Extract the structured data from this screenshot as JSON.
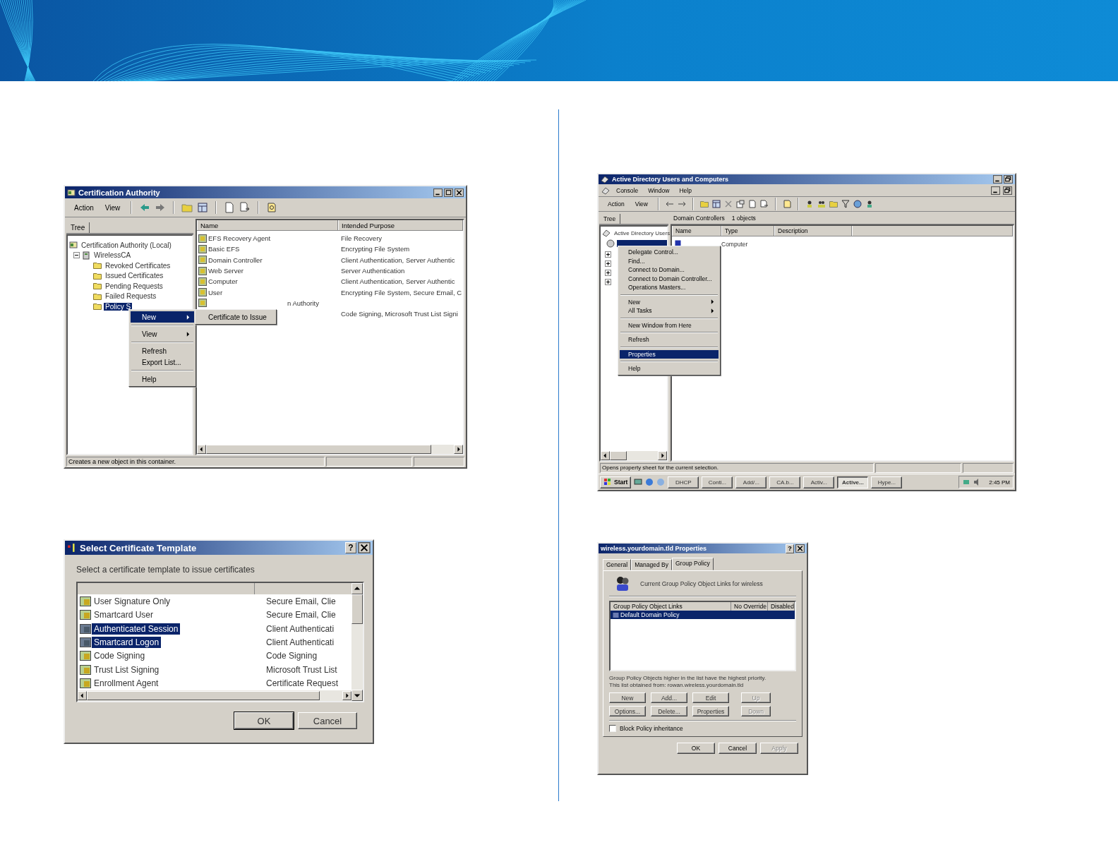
{
  "ca_window": {
    "title": "Certification Authority",
    "menu": [
      "Action",
      "View"
    ],
    "tree_tab": "Tree",
    "tree": [
      {
        "label": "Certification Authority (Local)",
        "selected": false,
        "children": [
          {
            "label": "WirelessCA",
            "selected": false,
            "children": [
              {
                "label": "Revoked Certificates",
                "selected": false
              },
              {
                "label": "Issued Certificates",
                "selected": false
              },
              {
                "label": "Pending Requests",
                "selected": false
              },
              {
                "label": "Failed Requests",
                "selected": false
              },
              {
                "label": "Policy S",
                "selected": true
              }
            ]
          }
        ]
      }
    ],
    "columns": [
      "Name",
      "Intended Purpose"
    ],
    "rows": [
      {
        "name": "EFS Recovery Agent",
        "purpose": "File Recovery"
      },
      {
        "name": "Basic EFS",
        "purpose": "Encrypting File System"
      },
      {
        "name": "Domain Controller",
        "purpose": "Client Authentication, Server Authentic"
      },
      {
        "name": "Web Server",
        "purpose": "Server Authentication"
      },
      {
        "name": "Computer",
        "purpose": "Client Authentication, Server Authentic"
      },
      {
        "name": "User",
        "purpose": "Encrypting File System, Secure Email, C"
      },
      {
        "name": "n Authority"
      },
      {
        "purpose": "Code Signing, Microsoft Trust List Signi"
      }
    ],
    "context_menu": [
      {
        "items": [
          {
            "label": "New",
            "submenu": true,
            "selected": true
          }
        ]
      },
      {
        "items": [
          {
            "label": "View",
            "submenu": true,
            "selected": false
          }
        ]
      },
      {
        "items": [
          {
            "label": "Refresh",
            "submenu": false,
            "selected": false
          },
          {
            "label": "Export List...",
            "submenu": false,
            "selected": false
          }
        ]
      },
      {
        "items": [
          {
            "label": "Help",
            "submenu": false,
            "selected": false
          }
        ]
      }
    ],
    "submenu": [
      {
        "label": "Certificate to Issue",
        "selected": false
      }
    ],
    "status_bar": "Creates a new object in this container."
  },
  "ad_window": {
    "title": "Active Directory Users and Computers",
    "menu": [
      "Console",
      "Window",
      "Help"
    ],
    "toolbar_menu": [
      "Action",
      "View"
    ],
    "tree_tab": "Tree",
    "pane_title": "Domain Controllers",
    "pane_count": "1 objects",
    "tree": [
      {
        "label": "Active Directory Users",
        "selected": false,
        "children": [
          {
            "selected": true
          }
        ]
      }
    ],
    "columns": [
      "Name",
      "Type",
      "Description"
    ],
    "rows": [
      {
        "type": "Computer"
      }
    ],
    "context_menu": [
      {
        "items": [
          {
            "label": "Delegate Control...",
            "submenu": false,
            "selected": false
          },
          {
            "label": "Find...",
            "submenu": false,
            "selected": false
          },
          {
            "label": "Connect to Domain...",
            "submenu": false,
            "selected": false
          },
          {
            "label": "Connect to Domain Controller...",
            "submenu": false,
            "selected": false
          },
          {
            "label": "Operations Masters...",
            "submenu": false,
            "selected": false
          }
        ]
      },
      {
        "items": [
          {
            "label": "New",
            "submenu": true,
            "selected": false
          },
          {
            "label": "All Tasks",
            "submenu": true,
            "selected": false
          }
        ]
      },
      {
        "items": [
          {
            "label": "New Window from Here",
            "submenu": false,
            "selected": false
          }
        ]
      },
      {
        "items": [
          {
            "label": "Refresh",
            "submenu": false,
            "selected": false
          }
        ]
      },
      {
        "items": [
          {
            "label": "Properties",
            "submenu": false,
            "selected": true
          }
        ]
      },
      {
        "items": [
          {
            "label": "Help",
            "submenu": false,
            "selected": false
          }
        ]
      }
    ],
    "status_bar": "Opens property sheet for the current selection.",
    "taskbar": {
      "start": "Start",
      "items": [
        {
          "label": "DHCP",
          "selected": false
        },
        {
          "label": "Conti...",
          "selected": false
        },
        {
          "label": "Add/...",
          "selected": false
        },
        {
          "label": "CA.b...",
          "selected": false
        },
        {
          "label": "Activ...",
          "selected": false
        },
        {
          "label": "Active...",
          "selected": true
        },
        {
          "label": "Hype...",
          "selected": false
        }
      ],
      "clock": "2:45 PM"
    }
  },
  "template_dialog": {
    "title": "Select Certificate Template",
    "help_button": "?",
    "prompt": "Select a certificate template to issue certificates",
    "rows": [
      {
        "name": "User Signature Only",
        "purpose": "Secure Email, Clie",
        "selected": false
      },
      {
        "name": "Smartcard User",
        "purpose": "Secure Email, Clie",
        "selected": false
      },
      {
        "name": "Authenticated Session",
        "purpose": "Client Authenticati",
        "selected": true
      },
      {
        "name": "Smartcard Logon",
        "purpose": "Client Authenticati",
        "selected": true
      },
      {
        "name": "Code Signing",
        "purpose": "Code Signing",
        "selected": false
      },
      {
        "name": "Trust List Signing",
        "purpose": "Microsoft Trust List",
        "selected": false
      },
      {
        "name": "Enrollment Agent",
        "purpose": "Certificate Request",
        "selected": false
      }
    ],
    "buttons": [
      "OK",
      "Cancel"
    ]
  },
  "properties_dialog": {
    "title": "wireless.yourdomain.tld Properties",
    "help_button": "?",
    "tabs": [
      {
        "label": "General",
        "selected": false
      },
      {
        "label": "Managed By",
        "selected": false
      },
      {
        "label": "Group Policy",
        "selected": true
      }
    ],
    "heading": "Current Group Policy Object Links for wireless",
    "columns": [
      "Group Policy Object Links",
      "No Override",
      "Disabled"
    ],
    "rows": [
      {
        "name": "Default Domain Policy",
        "selected": true
      }
    ],
    "notes": [
      "Group Policy Objects higher in the list have the highest priority.",
      "This list obtained from: rowan.wireless.yourdomain.tld"
    ],
    "buttons": [
      {
        "label": "New",
        "disabled": false
      },
      {
        "label": "Add...",
        "disabled": false
      },
      {
        "label": "Edit",
        "disabled": false
      },
      {
        "label": "Up",
        "disabled": true
      },
      {
        "label": "Options...",
        "disabled": false
      },
      {
        "label": "Delete...",
        "disabled": false
      },
      {
        "label": "Properties",
        "disabled": false
      },
      {
        "label": "Down",
        "disabled": true
      }
    ],
    "checkbox": {
      "label": "Block Policy inheritance",
      "checked": false
    },
    "footer_buttons": [
      {
        "label": "OK",
        "disabled": false
      },
      {
        "label": "Cancel",
        "disabled": false
      },
      {
        "label": "Apply",
        "disabled": true
      }
    ]
  }
}
